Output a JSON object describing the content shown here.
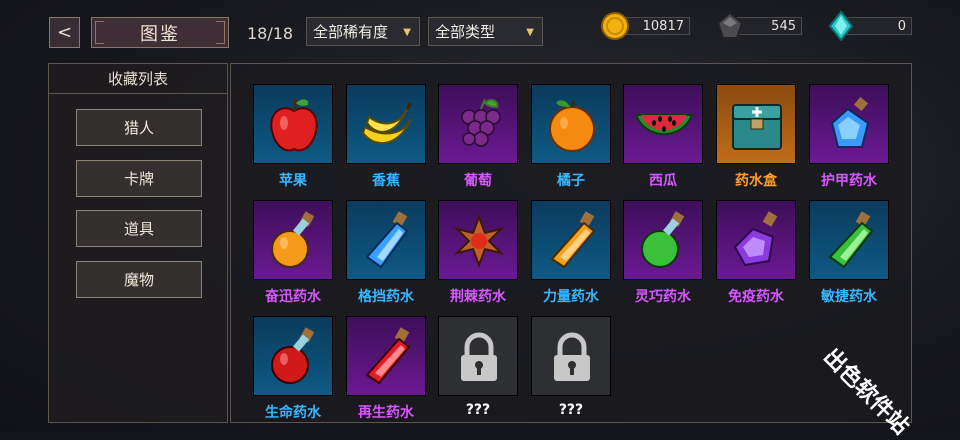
{
  "header": {
    "back_label": "<",
    "title": "图鉴",
    "count": "18/18",
    "rarity_filter": "全部稀有度",
    "type_filter": "全部类型"
  },
  "resources": [
    {
      "name": "gold",
      "value": "10817",
      "color": "#f2b20d"
    },
    {
      "name": "dark-crystal",
      "value": "545",
      "color": "#4a4a4f"
    },
    {
      "name": "teal-gem",
      "value": "0",
      "color": "#28c9c9"
    }
  ],
  "sidebar": {
    "title": "收藏列表",
    "items": [
      {
        "label": "猎人"
      },
      {
        "label": "卡牌"
      },
      {
        "label": "道具"
      },
      {
        "label": "魔物"
      }
    ]
  },
  "items": [
    {
      "name": "苹果",
      "rarity": "blue",
      "icon": "apple-icon"
    },
    {
      "name": "香蕉",
      "rarity": "blue",
      "icon": "banana-icon"
    },
    {
      "name": "葡萄",
      "rarity": "purple",
      "icon": "grapes-icon"
    },
    {
      "name": "橘子",
      "rarity": "blue",
      "icon": "orange-icon"
    },
    {
      "name": "西瓜",
      "rarity": "purple",
      "icon": "watermelon-icon"
    },
    {
      "name": "药水盒",
      "rarity": "orange",
      "icon": "potion-box-icon"
    },
    {
      "name": "护甲药水",
      "rarity": "purple",
      "icon": "armor-potion-icon"
    },
    {
      "name": "奋迅药水",
      "rarity": "purple",
      "icon": "haste-potion-icon"
    },
    {
      "name": "格挡药水",
      "rarity": "blue",
      "icon": "block-potion-icon"
    },
    {
      "name": "荆棘药水",
      "rarity": "purple",
      "icon": "thorns-potion-icon"
    },
    {
      "name": "力量药水",
      "rarity": "blue",
      "icon": "strength-potion-icon"
    },
    {
      "name": "灵巧药水",
      "rarity": "purple",
      "icon": "dexterity-potion-icon"
    },
    {
      "name": "免疫药水",
      "rarity": "purple",
      "icon": "immunity-potion-icon"
    },
    {
      "name": "敏捷药水",
      "rarity": "blue",
      "icon": "agility-potion-icon"
    },
    {
      "name": "生命药水",
      "rarity": "blue",
      "icon": "health-potion-icon"
    },
    {
      "name": "再生药水",
      "rarity": "purple",
      "icon": "regen-potion-icon"
    },
    {
      "name": "???",
      "rarity": "locked",
      "icon": "lock-icon"
    },
    {
      "name": "???",
      "rarity": "locked",
      "icon": "lock-icon"
    }
  ],
  "watermark": "出色软件站"
}
